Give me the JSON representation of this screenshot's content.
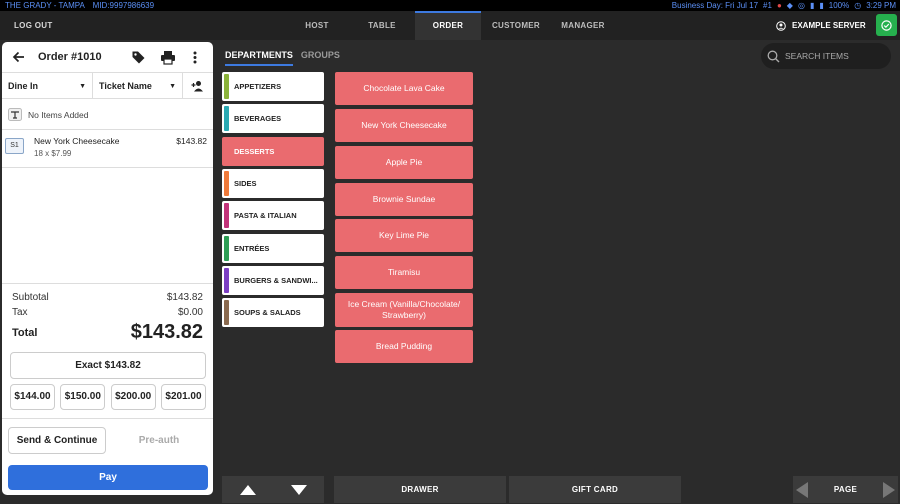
{
  "status_bar": {
    "location": "THE GRADY - TAMPA",
    "mid": "MID:9997986639",
    "business_day": "Business Day: Fri Jul 17",
    "terminal": "#1",
    "battery": "100%",
    "time": "3:29 PM",
    "color": "#5b8ff5"
  },
  "nav": {
    "logout": "LOG OUT",
    "tabs": [
      "HOST",
      "TABLE",
      "ORDER",
      "CUSTOMER",
      "MANAGER"
    ],
    "active_tab": "ORDER",
    "server_name": "EXAMPLE SERVER",
    "accent": "#3d7ae0",
    "ok_color": "#26b04e"
  },
  "order": {
    "title": "Order #1010",
    "dining_option": "Dine In",
    "ticket_name_label": "Ticket Name",
    "no_items_text": "No Items Added",
    "items": [
      {
        "seat": "S1",
        "name": "New York Cheesecake",
        "detail": "18 x $7.99",
        "price": "$143.82"
      }
    ],
    "subtotal_label": "Subtotal",
    "subtotal": "$143.82",
    "tax_label": "Tax",
    "tax": "$0.00",
    "total_label": "Total",
    "total": "$143.82",
    "exact_button": "Exact $143.82",
    "quick_amounts": [
      "$144.00",
      "$150.00",
      "$200.00",
      "$201.00"
    ],
    "send_button": "Send & Continue",
    "preauth_button": "Pre-auth",
    "pay_button": "Pay",
    "pay_color": "#2f6fdc"
  },
  "catalog": {
    "tabs": [
      "DEPARTMENTS",
      "GROUPS"
    ],
    "active_tab": "DEPARTMENTS",
    "search_placeholder": "SEARCH ITEMS",
    "departments": [
      {
        "label": "APPETIZERS",
        "color": "#8bb33a"
      },
      {
        "label": "BEVERAGES",
        "color": "#2aa9b3"
      },
      {
        "label": "DESSERTS",
        "color": "#ea6b6f"
      },
      {
        "label": "SIDES",
        "color": "#ef7a3a"
      },
      {
        "label": "PASTA & ITALIAN",
        "color": "#c2337a"
      },
      {
        "label": "ENTRÉES",
        "color": "#2e9e55"
      },
      {
        "label": "BURGERS & SANDWI...",
        "color": "#7c3fc4"
      },
      {
        "label": "SOUPS & SALADS",
        "color": "#8a6a4f"
      }
    ],
    "active_department": "DESSERTS",
    "active_color": "#ea6b6f",
    "menu_items": [
      "Chocolate Lava Cake",
      "New York Cheesecake",
      "Apple Pie",
      "Brownie Sundae",
      "Key Lime Pie",
      "Tiramisu",
      "Ice Cream (Vanilla/Chocolate/ Strawberry)",
      "Bread Pudding"
    ]
  },
  "bottom_bar": {
    "drawer": "DRAWER",
    "gift_card": "GIFT CARD",
    "page": "PAGE"
  }
}
